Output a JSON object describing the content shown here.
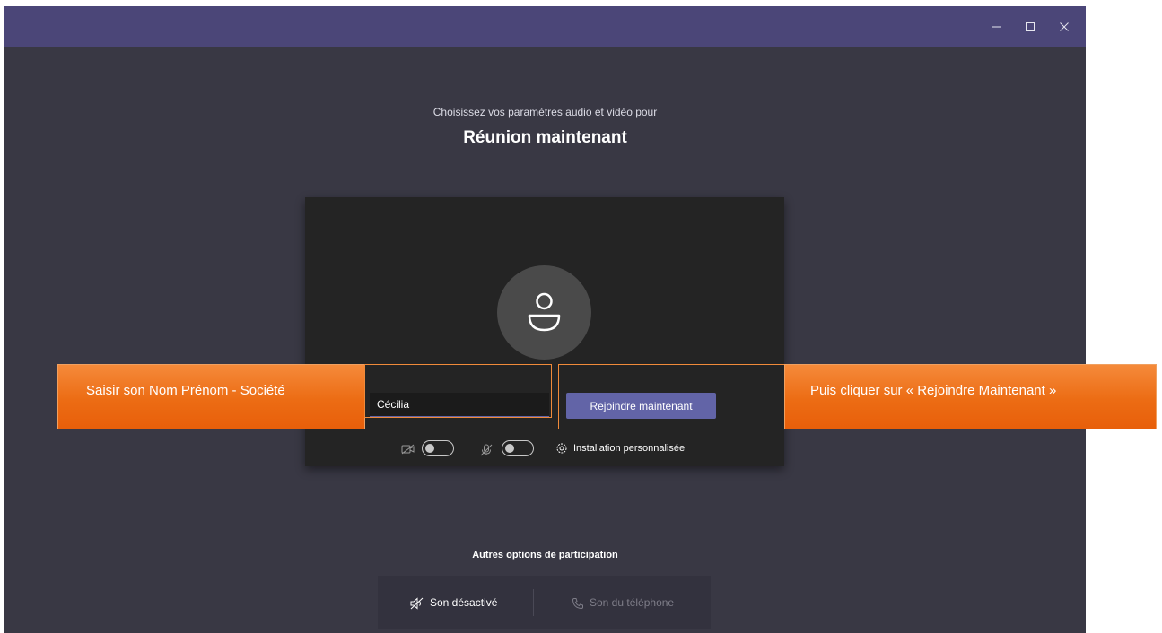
{
  "window": {
    "controls": {
      "minimize": "–",
      "maximize": "□",
      "close": "×"
    }
  },
  "header": {
    "subtitle": "Choisissez vos paramètres audio et vidéo pour",
    "title": "Réunion maintenant"
  },
  "prejoin": {
    "name_value": "Cécilia",
    "join_label": "Rejoindre maintenant",
    "video_toggle": {
      "state": "off",
      "icon": "video-off-icon"
    },
    "mic_toggle": {
      "state": "off",
      "icon": "mic-off-icon"
    },
    "custom_setup_label": "Installation personnalisée"
  },
  "other_options": {
    "heading": "Autres options de participation",
    "items": [
      {
        "label": "Son désactivé",
        "icon": "speaker-off-icon",
        "enabled": true
      },
      {
        "label": "Son du téléphone",
        "icon": "phone-icon",
        "enabled": false
      }
    ]
  },
  "annotations": {
    "left_callout": "Saisir son Nom Prénom - Société",
    "right_callout": "Puis cliquer sur « Rejoindre Maintenant »"
  },
  "colors": {
    "titlebar": "#4b4678",
    "background": "#393844",
    "accent": "#6264a7",
    "callout": "#ec6c14"
  }
}
